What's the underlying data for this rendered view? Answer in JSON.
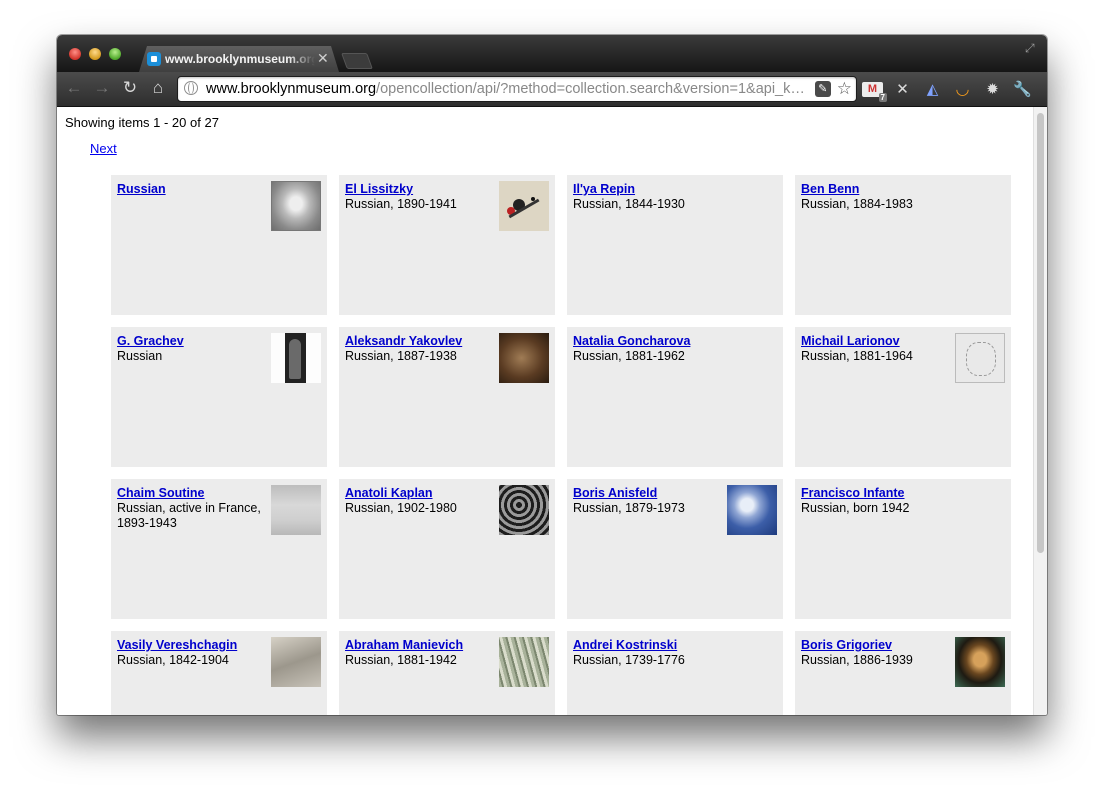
{
  "browser": {
    "tab_title": "www.brooklynmuseum.org/opencollection/api/",
    "tab_close_label": "✕",
    "url_host": "www.brooklynmuseum.org",
    "url_path": "/opencollection/api/?method=collection.search&version=1&api_k…",
    "nav": {
      "back": "←",
      "forward": "→",
      "reload": "↻",
      "home": "⌂"
    }
  },
  "page": {
    "status_text": "Showing items 1 - 20 of 27",
    "next_label": "Next"
  },
  "cards": [
    {
      "name": "Russian",
      "info": "",
      "thumb": "th-russian"
    },
    {
      "name": "El Lissitzky",
      "info": "Russian, 1890-1941",
      "thumb": "th-lissitzky"
    },
    {
      "name": "Il'ya Repin",
      "info": "Russian, 1844-1930",
      "thumb": ""
    },
    {
      "name": "Ben Benn",
      "info": "Russian, 1884-1983",
      "thumb": ""
    },
    {
      "name": "G. Grachev",
      "info": "Russian",
      "thumb": "th-grachev"
    },
    {
      "name": "Aleksandr Yakovlev",
      "info": "Russian, 1887-1938",
      "thumb": "th-yakovlev"
    },
    {
      "name": "Natalia Goncharova",
      "info": "Russian, 1881-1962",
      "thumb": ""
    },
    {
      "name": "Michail Larionov",
      "info": "Russian, 1881-1964",
      "thumb": "th-larionov"
    },
    {
      "name": "Chaim Soutine",
      "info": "Russian, active in France, 1893-1943",
      "thumb": "th-soutine"
    },
    {
      "name": "Anatoli Kaplan",
      "info": "Russian, 1902-1980",
      "thumb": "th-kaplan"
    },
    {
      "name": "Boris Anisfeld",
      "info": "Russian, 1879-1973",
      "thumb": "th-anisfeld"
    },
    {
      "name": "Francisco Infante",
      "info": "Russian, born 1942",
      "thumb": ""
    },
    {
      "name": "Vasily Vereshchagin",
      "info": "Russian, 1842-1904",
      "thumb": "th-vereshchagin"
    },
    {
      "name": "Abraham Manievich",
      "info": "Russian, 1881-1942",
      "thumb": "th-manievich"
    },
    {
      "name": "Andrei Kostrinski",
      "info": "Russian, 1739-1776",
      "thumb": ""
    },
    {
      "name": "Boris Grigoriev",
      "info": "Russian, 1886-1939",
      "thumb": "th-grigoriev"
    }
  ]
}
